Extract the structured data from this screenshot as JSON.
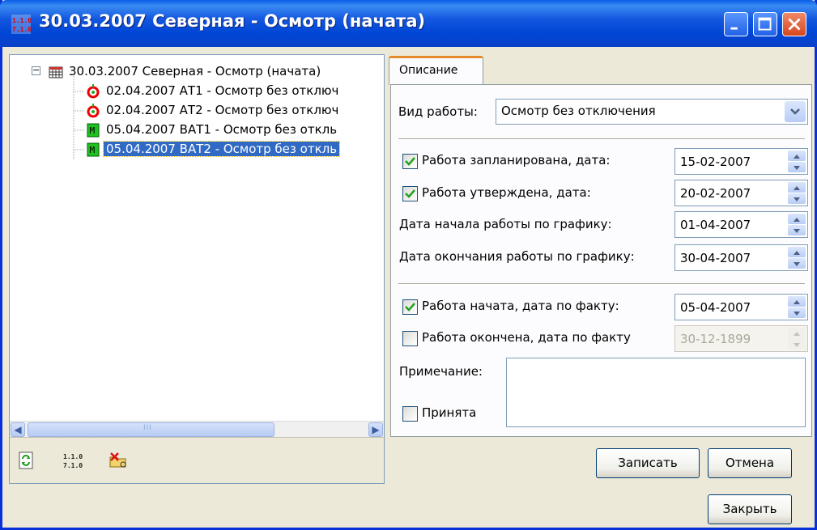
{
  "window": {
    "title": "30.03.2007 Северная - Осмотр (начата)",
    "title_icon": "app-calendar-icon",
    "controls": [
      "minimize-icon",
      "maximize-icon",
      "close-icon"
    ]
  },
  "tree": {
    "root": {
      "label": "30.03.2007 Северная - Осмотр (начата)",
      "icon": "calendar-grid-icon",
      "expanded": true
    },
    "items": [
      {
        "label": "02.04.2007 АТ1 - Осмотр без отключ",
        "icon": "red-ring-icon",
        "selected": false
      },
      {
        "label": "02.04.2007 АТ2 - Осмотр без отключ",
        "icon": "red-ring-icon",
        "selected": false
      },
      {
        "label": "05.04.2007 ВАТ1 - Осмотр без откль",
        "icon": "green-m-icon",
        "selected": false
      },
      {
        "label": "05.04.2007 ВАТ2 - Осмотр без откль",
        "icon": "green-m-icon",
        "selected": true
      }
    ],
    "scroll_grip": "III"
  },
  "toolbar": {
    "icons": [
      "refresh-icon",
      "calendar-icon",
      "delete-folder-icon"
    ]
  },
  "tab": {
    "label": "Описание"
  },
  "form": {
    "work_type_label": "Вид работы:",
    "work_type_value": "Осмотр без отключения",
    "planned_label": "Работа запланирована, дата:",
    "planned_checked": true,
    "planned_date": "15-02-2007",
    "approved_label": "Работа утверждена, дата:",
    "approved_checked": true,
    "approved_date": "20-02-2007",
    "sched_start_label": "Дата начала работы по графику:",
    "sched_start_date": "01-04-2007",
    "sched_end_label": "Дата окончания работы по графику:",
    "sched_end_date": "30-04-2007",
    "started_label": "Работа начата, дата по факту:",
    "started_checked": true,
    "started_date": "05-04-2007",
    "finished_label": "Работа окончена, дата по факту",
    "finished_checked": false,
    "finished_date": "30-12-1899",
    "note_label": "Примечание:",
    "note_value": "",
    "accepted_label": "Принята",
    "accepted_checked": false
  },
  "buttons": {
    "save": "Записать",
    "cancel": "Отмена",
    "close": "Закрыть"
  },
  "colors": {
    "title_blue": "#0046d6",
    "selection": "#316ac5",
    "tab_accent": "#e68b2c",
    "check_green": "#21a121"
  }
}
